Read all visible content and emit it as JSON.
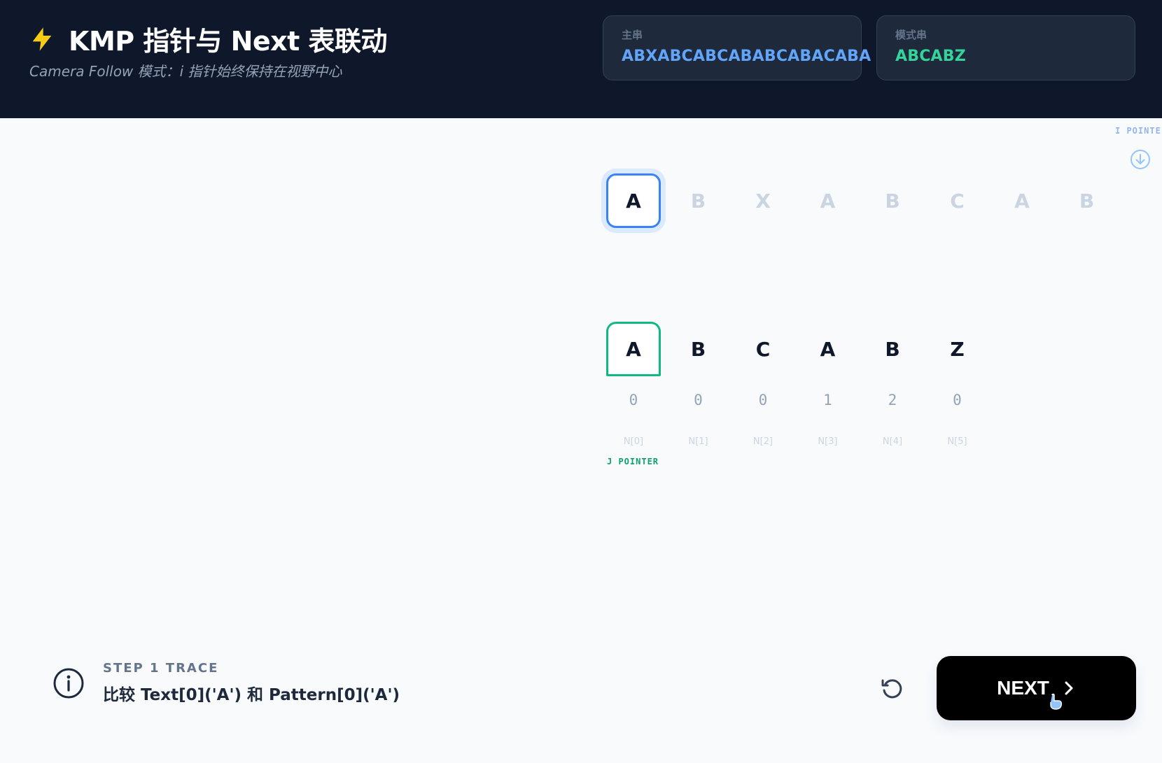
{
  "header": {
    "title": "KMP 指针与 Next 表联动",
    "subtitle": "Camera Follow 模式：i 指针始终保持在视野中心",
    "main_label": "主串",
    "main_value": "ABXABCABCABABCABACABA",
    "pattern_label": "模式串",
    "pattern_value": "ABCABZ"
  },
  "pointers": {
    "i_label": "I POINTE",
    "j_label": "J POINTER"
  },
  "text_cells": [
    "A",
    "B",
    "X",
    "A",
    "B",
    "C",
    "A",
    "B"
  ],
  "pattern_cells": [
    "A",
    "B",
    "C",
    "A",
    "B",
    "Z"
  ],
  "next_values": [
    "0",
    "0",
    "0",
    "1",
    "2",
    "0"
  ],
  "next_index_labels": [
    "N[0]",
    "N[1]",
    "N[2]",
    "N[3]",
    "N[4]",
    "N[5]"
  ],
  "trace": {
    "step_label": "STEP 1 TRACE",
    "text": "比较 Text[0]('A') 和 Pattern[0]('A')"
  },
  "controls": {
    "next_label": "NEXT"
  },
  "colors": {
    "header_bg": "#0f172a",
    "accent_blue": "#3b82f6",
    "accent_green": "#10b981",
    "bolt": "#facc15"
  }
}
